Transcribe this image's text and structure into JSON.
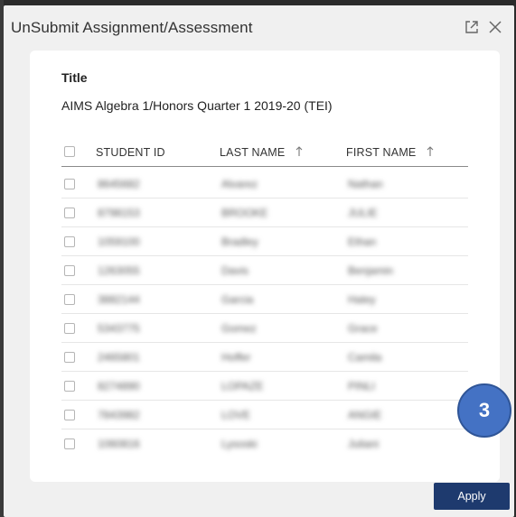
{
  "dialog": {
    "title": "UnSubmit Assignment/Assessment",
    "popout_icon": "popout-icon",
    "close_icon": "close-icon"
  },
  "card": {
    "title_label": "Title",
    "assignment_name": "AIMS Algebra 1/Honors Quarter 1 2019-20 (TEI)"
  },
  "table": {
    "columns": [
      "STUDENT ID",
      "LAST NAME",
      "FIRST NAME"
    ],
    "sort_icons": [
      "sort-up-icon",
      "sort-up-icon"
    ],
    "rows": [
      {
        "id": "8645682",
        "last": "Alvarez",
        "first": "Nathan"
      },
      {
        "id": "8798153",
        "last": "BROOKE",
        "first": "JULIE"
      },
      {
        "id": "1059100",
        "last": "Bradley",
        "first": "Ethan"
      },
      {
        "id": "1263055",
        "last": "Davis",
        "first": "Benjamin"
      },
      {
        "id": "3882144",
        "last": "Garcia",
        "first": "Haley"
      },
      {
        "id": "5343775",
        "last": "Gomez",
        "first": "Grace"
      },
      {
        "id": "2465801",
        "last": "Hoffer",
        "first": "Camila"
      },
      {
        "id": "8274890",
        "last": "LOPAZE",
        "first": "PINLI"
      },
      {
        "id": "7843982",
        "last": "LOVE",
        "first": "ANGIE"
      },
      {
        "id": "1060816",
        "last": "Lysoski",
        "first": "Juliani"
      }
    ]
  },
  "footer": {
    "apply_label": "Apply"
  },
  "badge": {
    "number": "3"
  },
  "colors": {
    "apply_bg": "#1e3a6e",
    "badge_bg": "#4472c4"
  }
}
